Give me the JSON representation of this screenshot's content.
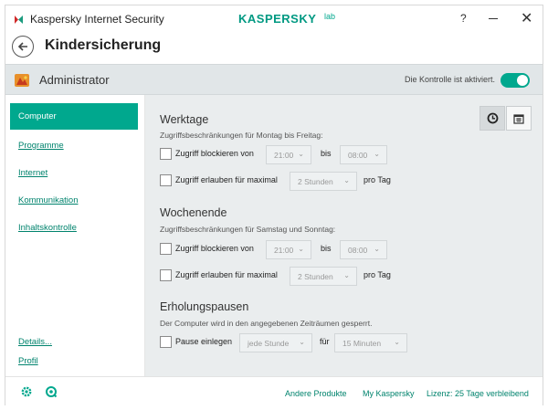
{
  "window": {
    "app_title": "Kaspersky Internet Security",
    "brand": "KASPERSKY",
    "brand_mark": "lab",
    "help": "?",
    "close": "✕"
  },
  "header": {
    "title": "Kindersicherung"
  },
  "userbar": {
    "user": "Administrator",
    "control_status": "Die Kontrolle ist aktiviert.",
    "control_enabled": true
  },
  "sidebar": {
    "active": "Computer",
    "items": [
      "Programme",
      "Internet",
      "Kommunikation",
      "Inhaltskontrolle"
    ],
    "bottom": [
      "Details...",
      "Profil"
    ]
  },
  "weekdays": {
    "title": "Werktage",
    "subtitle": "Zugriffsbeschränkungen für Montag bis Freitag:",
    "block_label": "Zugriff blockieren von",
    "block_from": "21:00",
    "bis": "bis",
    "block_to": "08:00",
    "allow_label": "Zugriff erlauben für maximal",
    "allow_value": "2 Stunden",
    "per_day": "pro Tag"
  },
  "weekend": {
    "title": "Wochenende",
    "subtitle": "Zugriffsbeschränkungen für Samstag und Sonntag:",
    "block_label": "Zugriff blockieren von",
    "block_from": "21:00",
    "bis": "bis",
    "block_to": "08:00",
    "allow_label": "Zugriff erlauben für maximal",
    "allow_value": "2 Stunden",
    "per_day": "pro Tag"
  },
  "breaks": {
    "title": "Erholungspausen",
    "subtitle": "Der Computer wird in den angegebenen Zeiträumen gesperrt.",
    "pause_label": "Pause einlegen",
    "interval": "jede Stunde",
    "fuer": "für",
    "duration": "15 Minuten"
  },
  "footer": {
    "links": [
      "Andere Produkte",
      "My Kaspersky",
      "Lizenz: 25 Tage verbleibend"
    ]
  },
  "colors": {
    "accent": "#00a88e",
    "link": "#00836d",
    "panel": "#eaedee"
  }
}
